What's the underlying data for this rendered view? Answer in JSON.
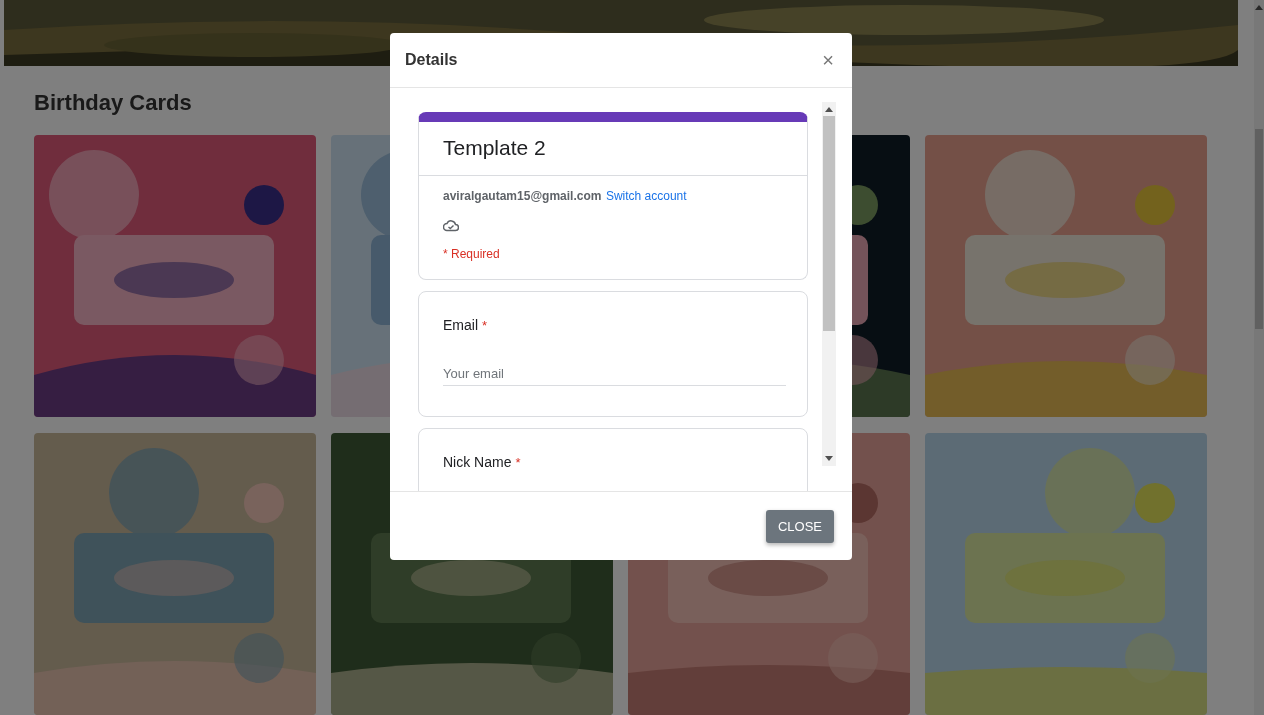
{
  "section": {
    "title": "Birthday Cards"
  },
  "dialog": {
    "title": "Details",
    "close_icon": "×",
    "form": {
      "title": "Template 2",
      "account": "aviralgautam15@gmail.com",
      "switch_link": "Switch account",
      "required_note": "* Required",
      "questions": [
        {
          "label": "Email",
          "required_mark": "*",
          "placeholder": "Your email"
        },
        {
          "label": "Nick Name",
          "required_mark": "*"
        }
      ]
    },
    "button": "CLOSE"
  }
}
